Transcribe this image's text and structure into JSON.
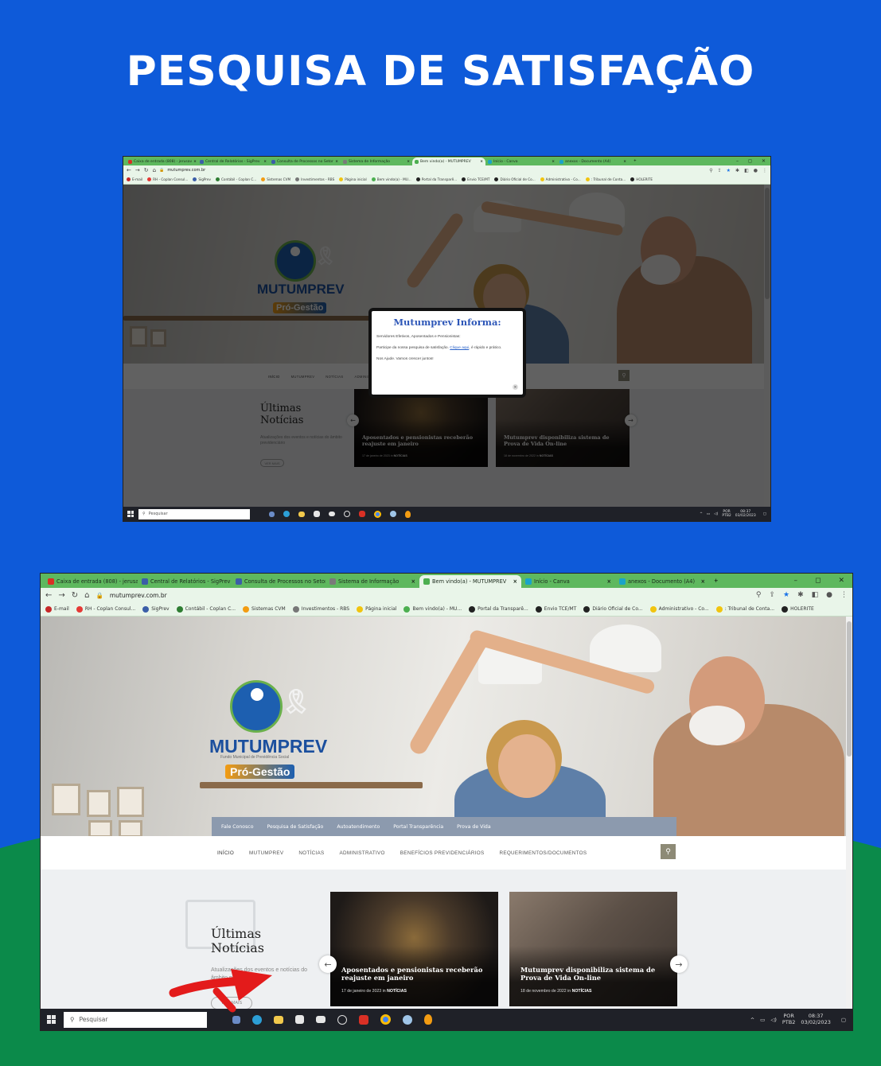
{
  "poster": {
    "headline": "PESQUISA DE SATISFAÇÃO",
    "colors": {
      "blue": "#0e5ad9",
      "green": "#0b8a4a",
      "headline": "#ffffff"
    }
  },
  "browser": {
    "tabs": [
      {
        "label": "Caixa de entrada (808) - jerusav",
        "icon": "gmail-icon"
      },
      {
        "label": "Central de Relatórios - SigPrev",
        "icon": "sigprev-icon"
      },
      {
        "label": "Consulta de Processos no Setor",
        "icon": "sigprev-icon"
      },
      {
        "label": "Sistema de Informação",
        "icon": "globe-icon"
      },
      {
        "label": "Bem vindo(a) - MUTUMPREV",
        "icon": "mutumprev-icon",
        "active": true
      },
      {
        "label": "Início - Canva",
        "icon": "canva-icon"
      },
      {
        "label": "anexos - Documento (A4)",
        "icon": "canva-icon"
      }
    ],
    "tabs_small": [
      {
        "label": "Caixa de entrada (808) - jerusav"
      },
      {
        "label": "Central de Relatórios - SigPrev"
      },
      {
        "label": "Consulta de Processos no Setor"
      },
      {
        "label": "Sistema de Informação"
      },
      {
        "label": "Bem vindo(a) - MUTUMPREV"
      },
      {
        "label": "Início - Canva"
      },
      {
        "label": "anexos - Documento (A4)"
      }
    ],
    "url": "mutumprev.com.br",
    "bookmarks": [
      "E-mail",
      "RH - Coplan Consul...",
      "SigPrev",
      "Contábil - Coplan C...",
      "Sistemas CVM",
      "Investimentos - RBS",
      "Página inicial",
      "Bem vindo(a) - MU...",
      "Portal da Transparê...",
      "Envio TCE/MT",
      "Diário Oficial de Co...",
      "Administrativo - Co...",
      ": Tribunal de Conta...",
      "HOLERITE"
    ]
  },
  "site": {
    "logo_title": "MUTUMPREV",
    "logo_subtitle": "Fundo Municipal de Previdência Social",
    "logo_badge": "Pró-Gestão",
    "top_menu": [
      "Fale Conosco",
      "Pesquisa de Satisfação",
      "Autoatendimento",
      "Portal Transparência",
      "Prova de Vida"
    ],
    "main_nav": [
      "INÍCIO",
      "MUTUMPREV",
      "NOTÍCIAS",
      "ADMINISTRATIVO",
      "BENEFÍCIOS PREVIDENCIÁRIOS",
      "REQUERIMENTOS/DOCUMENTOS"
    ],
    "news_heading_1": "Últimas",
    "news_heading_2": "Notícias",
    "news_desc": "Atualizações dos eventos e notícias do âmbito previdenciário",
    "news_more": "VER MAIS",
    "cards": [
      {
        "title": "Aposentados e pensionistas receberão reajuste em janeiro",
        "date": "17 de janeiro de 2023 in",
        "category": "NOTÍCIAS"
      },
      {
        "title": "Mutumprev disponibiliza sistema de Prova de Vida On-line",
        "date": "18 de novembro de 2022 in",
        "category": "NOTÍCIAS"
      }
    ]
  },
  "modal": {
    "title": "Mutumprev Informa:",
    "line1": "Servidores Efetivos, Aposentados e Pensionistas:",
    "line2_a": "Participe da nossa pesquisa de satisfação. ",
    "line2_link": "Clique aqui",
    "line2_b": ", é rápido e prático.",
    "line3": "Nos Ajude. Vamos crescer juntos!"
  },
  "taskbar": {
    "search_placeholder": "Pesquisar",
    "lang": "POR",
    "lang2": "PTB2",
    "time": "08:37",
    "date": "03/02/2023"
  },
  "window_controls": {
    "minimize": "–",
    "maximize": "◻",
    "close": "✕"
  }
}
